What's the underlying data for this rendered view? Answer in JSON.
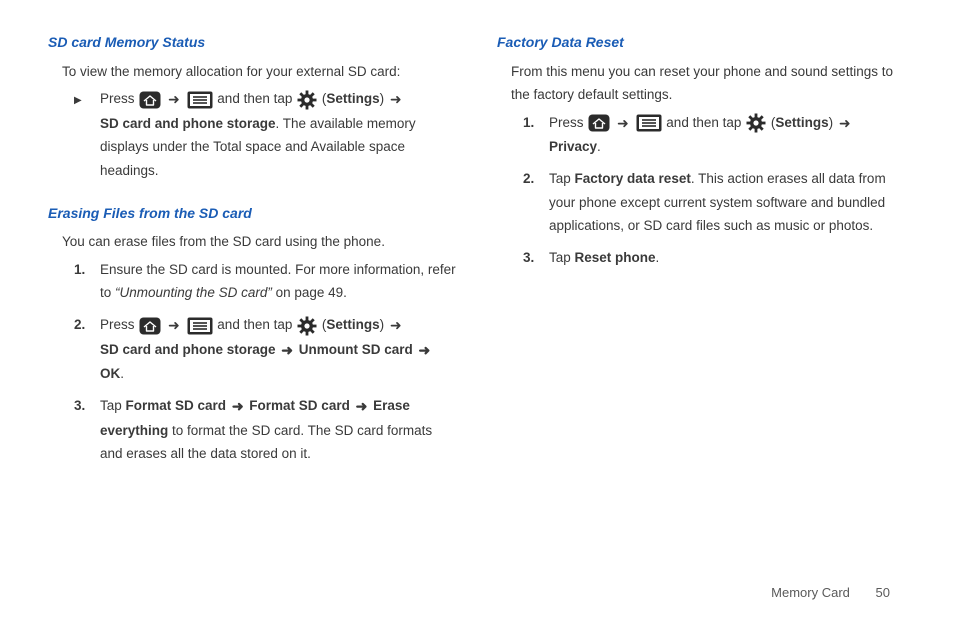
{
  "left": {
    "sec1": {
      "heading": "SD card Memory Status",
      "intro": "To view the memory allocation for your external SD card:",
      "step": {
        "pre": "Press ",
        "mid": " and then tap ",
        "settings_open": "(",
        "settings_label": "Settings",
        "settings_close": ") ",
        "after": "SD card and phone storage",
        "tail": ". The available memory displays under the Total space and Available space headings."
      }
    },
    "sec2": {
      "heading": "Erasing Files from the SD card",
      "intro": "You can erase files from the SD card using the phone.",
      "steps": [
        {
          "num": "1.",
          "text_a": "Ensure the SD card is mounted. For more information, refer to ",
          "ref": "“Unmounting the SD card”",
          "ref_page": "  on page 49."
        },
        {
          "num": "2.",
          "pre": "Press ",
          "mid": " and then tap ",
          "settings_open": "(",
          "settings_label": "Settings",
          "settings_close": ") ",
          "after1": "SD card and phone storage ",
          "after2": " Unmount SD card ",
          "after3": " OK",
          "period": "."
        },
        {
          "num": "3.",
          "pre": "Tap ",
          "b1": "Format SD card ",
          "b2": " Format SD card ",
          "b3": "  Erase everything",
          "tail": " to format the SD card. The SD card formats and erases all the data stored on it."
        }
      ]
    }
  },
  "right": {
    "sec1": {
      "heading": "Factory Data Reset",
      "intro": "From this menu you can reset your phone and sound settings to the factory default settings.",
      "steps": [
        {
          "num": "1.",
          "pre": "Press ",
          "mid": " and then tap ",
          "settings_open": "(",
          "settings_label": "Settings",
          "settings_close": ") ",
          "after": "Privacy",
          "period": "."
        },
        {
          "num": "2.",
          "pre": "Tap ",
          "b": "Factory data reset",
          "tail": ". This action erases all data from your phone except current system software and bundled applications, or SD card files such as music or photos."
        },
        {
          "num": "3.",
          "pre": "Tap ",
          "b": "Reset phone",
          "period": "."
        }
      ]
    }
  },
  "footer": {
    "section": "Memory Card",
    "page": "50"
  },
  "arrows": {
    "thick": "➜"
  }
}
